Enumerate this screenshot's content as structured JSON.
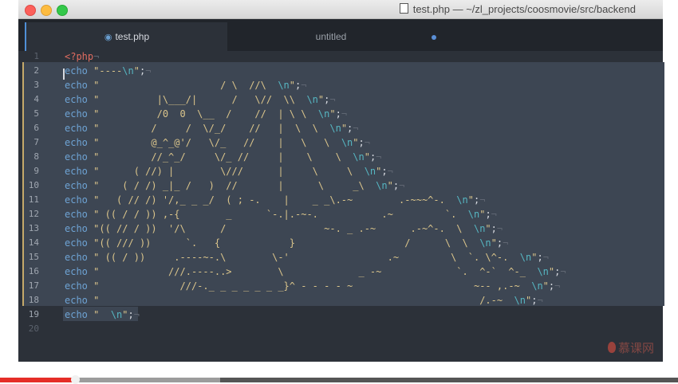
{
  "window": {
    "title": "test.php — ~/zl_projects/coosmovie/src/backend",
    "title_icon": "document-icon"
  },
  "tabs": [
    {
      "label": "test.php",
      "icon": "php-elephant-icon",
      "active": true
    },
    {
      "label": "untitled",
      "active": false,
      "modified": true
    }
  ],
  "editor": {
    "line_numbers": [
      "1",
      "2",
      "3",
      "4",
      "5",
      "6",
      "7",
      "8",
      "9",
      "10",
      "11",
      "12",
      "13",
      "14",
      "15",
      "16",
      "17",
      "18",
      "19",
      "20"
    ],
    "code_lines": [
      [
        {
          "t": "tag",
          "v": "<?php"
        },
        {
          "t": "ws",
          "v": "¬"
        }
      ],
      [
        {
          "t": "kw",
          "v": "echo"
        },
        {
          "t": "pun",
          "v": " "
        },
        {
          "t": "str",
          "v": "\"----"
        },
        {
          "t": "esc",
          "v": "\\n"
        },
        {
          "t": "str",
          "v": "\""
        },
        {
          "t": "pun",
          "v": ";"
        },
        {
          "t": "ws",
          "v": "¬"
        }
      ],
      [
        {
          "t": "kw",
          "v": "echo"
        },
        {
          "t": "pun",
          "v": " "
        },
        {
          "t": "str",
          "v": "\"                     / \\  //\\  "
        },
        {
          "t": "esc",
          "v": "\\n"
        },
        {
          "t": "str",
          "v": "\""
        },
        {
          "t": "pun",
          "v": ";"
        },
        {
          "t": "ws",
          "v": "¬"
        }
      ],
      [
        {
          "t": "kw",
          "v": "echo"
        },
        {
          "t": "pun",
          "v": " "
        },
        {
          "t": "str",
          "v": "\"          |\\___/|      /   \\//  \\\\  "
        },
        {
          "t": "esc",
          "v": "\\n"
        },
        {
          "t": "str",
          "v": "\""
        },
        {
          "t": "pun",
          "v": ";"
        },
        {
          "t": "ws",
          "v": "¬"
        }
      ],
      [
        {
          "t": "kw",
          "v": "echo"
        },
        {
          "t": "pun",
          "v": " "
        },
        {
          "t": "str",
          "v": "\"          /0  0  \\__  /    //  | \\ \\  "
        },
        {
          "t": "esc",
          "v": "\\n"
        },
        {
          "t": "str",
          "v": "\""
        },
        {
          "t": "pun",
          "v": ";"
        },
        {
          "t": "ws",
          "v": "¬"
        }
      ],
      [
        {
          "t": "kw",
          "v": "echo"
        },
        {
          "t": "pun",
          "v": " "
        },
        {
          "t": "str",
          "v": "\"         /     /  \\/_/    //   |  \\  \\  "
        },
        {
          "t": "esc",
          "v": "\\n"
        },
        {
          "t": "str",
          "v": "\""
        },
        {
          "t": "pun",
          "v": ";"
        },
        {
          "t": "ws",
          "v": "¬"
        }
      ],
      [
        {
          "t": "kw",
          "v": "echo"
        },
        {
          "t": "pun",
          "v": " "
        },
        {
          "t": "str",
          "v": "\"         @_^_@'/   \\/_   //    |   \\   \\  "
        },
        {
          "t": "esc",
          "v": "\\n"
        },
        {
          "t": "str",
          "v": "\""
        },
        {
          "t": "pun",
          "v": ";"
        },
        {
          "t": "ws",
          "v": "¬"
        }
      ],
      [
        {
          "t": "kw",
          "v": "echo"
        },
        {
          "t": "pun",
          "v": " "
        },
        {
          "t": "str",
          "v": "\"         //_^_/     \\/_ //     |    \\    \\  "
        },
        {
          "t": "esc",
          "v": "\\n"
        },
        {
          "t": "str",
          "v": "\""
        },
        {
          "t": "pun",
          "v": ";"
        },
        {
          "t": "ws",
          "v": "¬"
        }
      ],
      [
        {
          "t": "kw",
          "v": "echo"
        },
        {
          "t": "pun",
          "v": " "
        },
        {
          "t": "str",
          "v": "\"      ( //) |        \\///      |     \\     \\  "
        },
        {
          "t": "esc",
          "v": "\\n"
        },
        {
          "t": "str",
          "v": "\""
        },
        {
          "t": "pun",
          "v": ";"
        },
        {
          "t": "ws",
          "v": "¬"
        }
      ],
      [
        {
          "t": "kw",
          "v": "echo"
        },
        {
          "t": "pun",
          "v": " "
        },
        {
          "t": "str",
          "v": "\"    ( / /) _|_ /   )  //       |      \\     _\\  "
        },
        {
          "t": "esc",
          "v": "\\n"
        },
        {
          "t": "str",
          "v": "\""
        },
        {
          "t": "pun",
          "v": ";"
        },
        {
          "t": "ws",
          "v": "¬"
        }
      ],
      [
        {
          "t": "kw",
          "v": "echo"
        },
        {
          "t": "pun",
          "v": " "
        },
        {
          "t": "str",
          "v": "\"   ( // /) '/,_ _ _/  ( ; -.    |    _ _\\.-~        .-~~~^-.  "
        },
        {
          "t": "esc",
          "v": "\\n"
        },
        {
          "t": "str",
          "v": "\""
        },
        {
          "t": "pun",
          "v": ";"
        },
        {
          "t": "ws",
          "v": "¬"
        }
      ],
      [
        {
          "t": "kw",
          "v": "echo"
        },
        {
          "t": "pun",
          "v": " "
        },
        {
          "t": "str",
          "v": "\" (( / / )) ,-{        _      `-.|.-~-.           .~         `.  "
        },
        {
          "t": "esc",
          "v": "\\n"
        },
        {
          "t": "str",
          "v": "\""
        },
        {
          "t": "pun",
          "v": ";"
        },
        {
          "t": "ws",
          "v": "¬"
        }
      ],
      [
        {
          "t": "kw",
          "v": "echo"
        },
        {
          "t": "pun",
          "v": " "
        },
        {
          "t": "str",
          "v": "\"(( // / ))  '/\\      /                 ~-. _ .-~      .-~^-.  \\  "
        },
        {
          "t": "esc",
          "v": "\\n"
        },
        {
          "t": "str",
          "v": "\""
        },
        {
          "t": "pun",
          "v": ";"
        },
        {
          "t": "ws",
          "v": "¬"
        }
      ],
      [
        {
          "t": "kw",
          "v": "echo"
        },
        {
          "t": "pun",
          "v": " "
        },
        {
          "t": "str",
          "v": "\"(( /// ))      `.   {            }                   /      \\  \\  "
        },
        {
          "t": "esc",
          "v": "\\n"
        },
        {
          "t": "str",
          "v": "\""
        },
        {
          "t": "pun",
          "v": ";"
        },
        {
          "t": "ws",
          "v": "¬"
        }
      ],
      [
        {
          "t": "kw",
          "v": "echo"
        },
        {
          "t": "pun",
          "v": " "
        },
        {
          "t": "str",
          "v": "\" (( / ))     .----~-.\\        \\-'                 .~         \\  `. \\^-.  "
        },
        {
          "t": "esc",
          "v": "\\n"
        },
        {
          "t": "str",
          "v": "\""
        },
        {
          "t": "pun",
          "v": ";"
        },
        {
          "t": "ws",
          "v": "¬"
        }
      ],
      [
        {
          "t": "kw",
          "v": "echo"
        },
        {
          "t": "pun",
          "v": " "
        },
        {
          "t": "str",
          "v": "\"            ///.----..>        \\             _ -~             `.  ^-`  ^-_  "
        },
        {
          "t": "esc",
          "v": "\\n"
        },
        {
          "t": "str",
          "v": "\""
        },
        {
          "t": "pun",
          "v": ";"
        },
        {
          "t": "ws",
          "v": "¬"
        }
      ],
      [
        {
          "t": "kw",
          "v": "echo"
        },
        {
          "t": "pun",
          "v": " "
        },
        {
          "t": "str",
          "v": "\"              ///-._ _ _ _ _ _ _}^ - - - - ~                     ~-- ,.-~  "
        },
        {
          "t": "esc",
          "v": "\\n"
        },
        {
          "t": "str",
          "v": "\""
        },
        {
          "t": "pun",
          "v": ";"
        },
        {
          "t": "ws",
          "v": "¬"
        }
      ],
      [
        {
          "t": "kw",
          "v": "echo"
        },
        {
          "t": "pun",
          "v": " "
        },
        {
          "t": "str",
          "v": "\"                                                                  /.-~  "
        },
        {
          "t": "esc",
          "v": "\\n"
        },
        {
          "t": "str",
          "v": "\""
        },
        {
          "t": "pun",
          "v": ";"
        },
        {
          "t": "ws",
          "v": "¬"
        }
      ],
      [
        {
          "t": "kw",
          "v": "echo"
        },
        {
          "t": "pun",
          "v": " "
        },
        {
          "t": "str",
          "v": "\"  "
        },
        {
          "t": "esc",
          "v": "\\n"
        },
        {
          "t": "str",
          "v": "\""
        },
        {
          "t": "pun",
          "v": ";"
        },
        {
          "t": "ws",
          "v": "¬"
        }
      ],
      []
    ]
  },
  "watermark": {
    "text": "慕课网",
    "icon": "flame-icon"
  },
  "video": {
    "played_fraction": 0.111,
    "buffered_fraction": 0.325
  }
}
